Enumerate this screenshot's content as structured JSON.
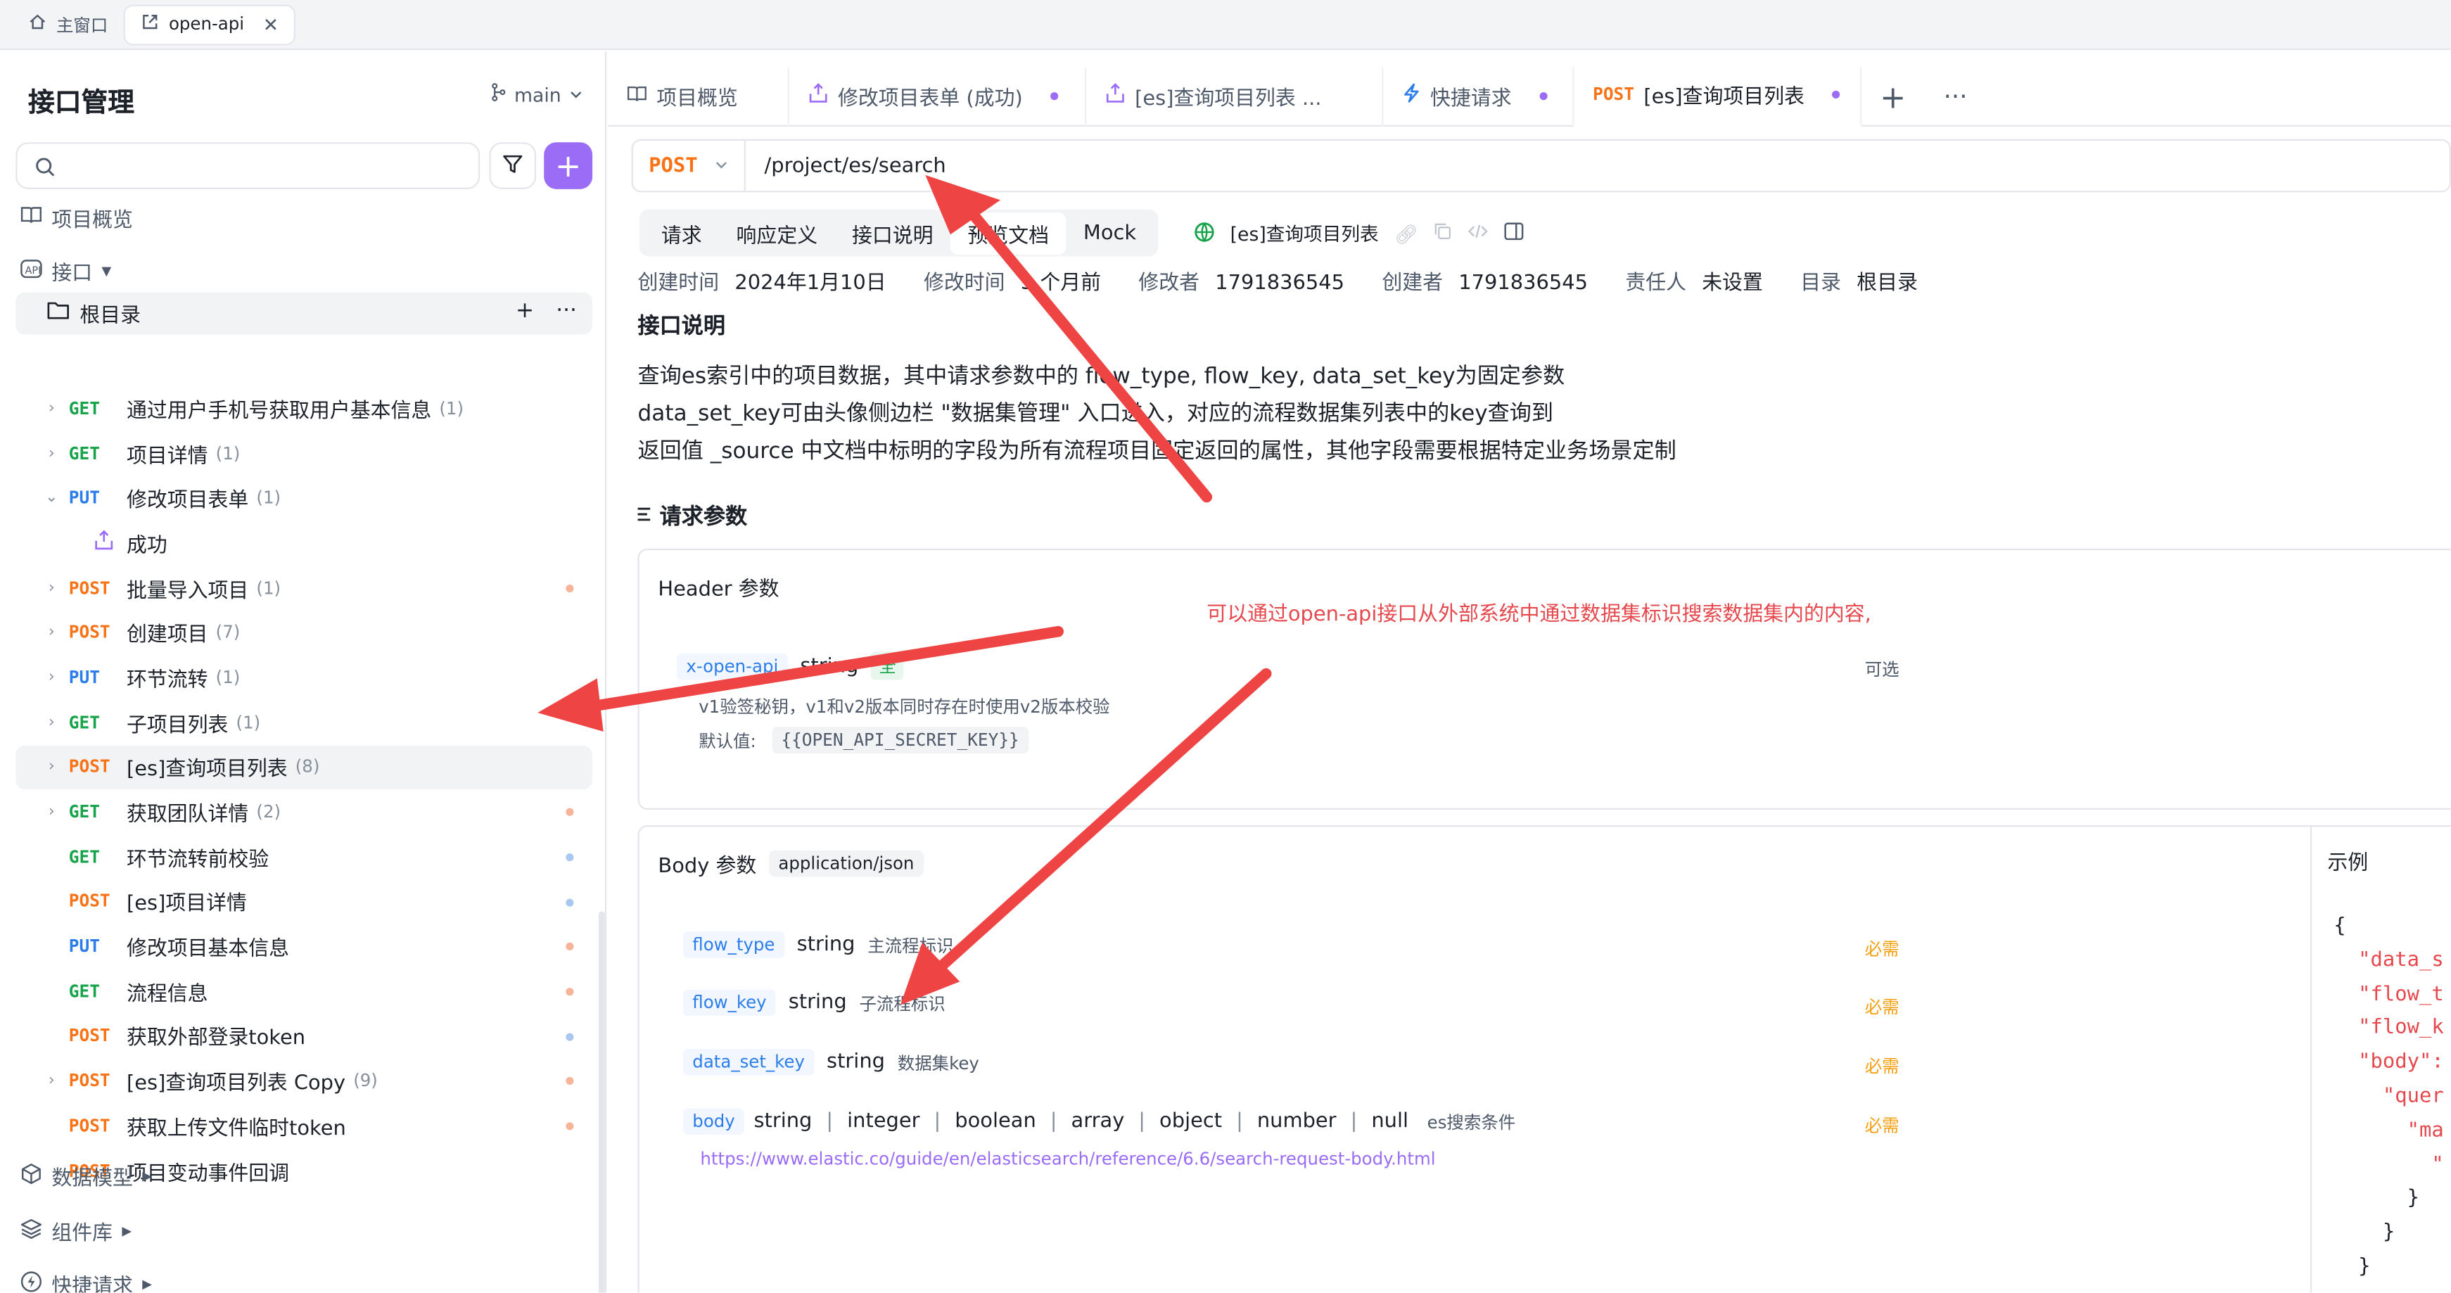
{
  "window_tabs": [
    {
      "label": "主窗口",
      "icon": "home-icon"
    },
    {
      "label": "open-api",
      "icon": "external-link-icon",
      "close": "✕"
    }
  ],
  "sidebar": {
    "title": "接口管理",
    "branch": "main",
    "search": {
      "placeholder": "",
      "value": ""
    },
    "add_label": "+",
    "overview": "项目概览",
    "interfaces": "接口",
    "root": {
      "label": "根目录",
      "add": "+",
      "more": "···"
    },
    "items": [
      {
        "chev": "›",
        "method": "GET",
        "name": "通过用户手机号获取用户基本信息",
        "count": "(1)",
        "dot": ""
      },
      {
        "chev": "›",
        "method": "GET",
        "name": "项目详情",
        "count": "(1)",
        "dot": ""
      },
      {
        "chev": "⌄",
        "method": "PUT",
        "name": "修改项目表单",
        "count": "(1)",
        "dot": ""
      },
      {
        "chev": "",
        "method": "",
        "name": "成功",
        "count": "",
        "dot": "",
        "child": true
      },
      {
        "chev": "›",
        "method": "POST",
        "name": "批量导入项目",
        "count": "(1)",
        "dot": "#f7b499"
      },
      {
        "chev": "›",
        "method": "POST",
        "name": "创建项目",
        "count": "(7)",
        "dot": ""
      },
      {
        "chev": "›",
        "method": "PUT",
        "name": "环节流转",
        "count": "(1)",
        "dot": ""
      },
      {
        "chev": "›",
        "method": "GET",
        "name": "子项目列表",
        "count": "(1)",
        "dot": ""
      },
      {
        "chev": "›",
        "method": "POST",
        "name": "[es]查询项目列表",
        "count": "(8)",
        "dot": "",
        "selected": true
      },
      {
        "chev": "›",
        "method": "GET",
        "name": "获取团队详情",
        "count": "(2)",
        "dot": "#f7b499"
      },
      {
        "chev": "",
        "method": "GET",
        "name": "环节流转前校验",
        "count": "",
        "dot": "#a8c8f0"
      },
      {
        "chev": "",
        "method": "POST",
        "name": "[es]项目详情",
        "count": "",
        "dot": "#a8c8f0"
      },
      {
        "chev": "",
        "method": "PUT",
        "name": "修改项目基本信息",
        "count": "",
        "dot": "#f7b499"
      },
      {
        "chev": "",
        "method": "GET",
        "name": "流程信息",
        "count": "",
        "dot": "#f7b499"
      },
      {
        "chev": "",
        "method": "POST",
        "name": "获取外部登录token",
        "count": "",
        "dot": "#a8c8f0"
      },
      {
        "chev": "›",
        "method": "POST",
        "name": "[es]查询项目列表 Copy",
        "count": "(9)",
        "dot": "#f7b499"
      },
      {
        "chev": "",
        "method": "POST",
        "name": "获取上传文件临时token",
        "count": "",
        "dot": "#f7b499"
      },
      {
        "chev": "",
        "method": "POST",
        "name": "项目变动事件回调",
        "count": "",
        "dot": ""
      }
    ],
    "bottom": [
      {
        "label": "数据模型",
        "icon": "cube-icon"
      },
      {
        "label": "组件库",
        "icon": "layers-icon"
      },
      {
        "label": "快捷请求",
        "icon": "bolt-icon"
      }
    ]
  },
  "tabs": [
    {
      "label": "项目概览",
      "icon": "book-icon",
      "dot": false
    },
    {
      "label": "修改项目表单 (成功)",
      "icon": "case-icon",
      "dot": true
    },
    {
      "label": "[es]查询项目列表 ...",
      "icon": "case-icon",
      "dot": false
    },
    {
      "label": "快捷请求",
      "icon": "bolt-icon",
      "dot": true
    },
    {
      "method": "POST",
      "label": "[es]查询项目列表",
      "dot": true,
      "active": true
    }
  ],
  "url": {
    "method": "POST",
    "path": "/project/es/search"
  },
  "subtabs": [
    "请求",
    "响应定义",
    "接口说明",
    "预览文档",
    "Mock"
  ],
  "subinfo": {
    "name": "[es]查询项目列表"
  },
  "meta": [
    {
      "k": "创建时间",
      "v": "2024年1月10日"
    },
    {
      "k": "修改时间",
      "v": "3 个月前"
    },
    {
      "k": "修改者",
      "v": "1791836545"
    },
    {
      "k": "创建者",
      "v": "1791836545"
    },
    {
      "k": "责任人",
      "v": "未设置"
    },
    {
      "k": "目录",
      "v": "根目录"
    }
  ],
  "description": {
    "title": "接口说明",
    "lines": [
      "查询es索引中的项目数据，其中请求参数中的 flow_type, flow_key, data_set_key为固定参数",
      "data_set_key可由头像侧边栏 \"数据集管理\" 入口进入，对应的流程数据集列表中的key查询到",
      "返回值 _source 中文档中标明的字段为所有流程项目固定返回的属性，其他字段需要根据特定业务场景定制"
    ]
  },
  "request_params_title": "请求参数",
  "header": {
    "title": "Header 参数",
    "param": {
      "name": "x-open-api",
      "type": "string",
      "badge": "全",
      "desc": "v1验签秘钥，v1和v2版本同时存在时使用v2版本校验",
      "default_label": "默认值:",
      "default": "{{OPEN_API_SECRET_KEY}}",
      "required": "可选"
    }
  },
  "body": {
    "title": "Body 参数",
    "content_type": "application/json",
    "params": [
      {
        "name": "flow_type",
        "type": "string",
        "desc": "主流程标识",
        "required": "必需"
      },
      {
        "name": "flow_key",
        "type": "string",
        "desc": "子流程标识",
        "required": "必需"
      },
      {
        "name": "data_set_key",
        "type": "string",
        "desc": "数据集key",
        "required": "必需"
      },
      {
        "name": "body",
        "types": [
          "string",
          "integer",
          "boolean",
          "array",
          "object",
          "number",
          "null"
        ],
        "desc": "es搜索条件",
        "required": "必需",
        "link": "https://www.elastic.co/guide/en/elasticsearch/reference/6.6/search-request-body.html"
      }
    ]
  },
  "example": {
    "title": "示例",
    "lines": [
      "{",
      "  \"data_s",
      "  \"flow_t",
      "  \"flow_k",
      "  \"body\":",
      "    \"quer",
      "      \"ma",
      "        \"",
      "      }",
      "    }",
      "  }"
    ]
  },
  "annotation": "可以通过open-api接口从外部系统中通过数据集标识搜索数据集内的内容,",
  "colors": {
    "accent": "#9b6cf5",
    "get": "#16a34a",
    "put": "#2b7de9",
    "post": "#f97316",
    "arrow": "#ee4444"
  }
}
